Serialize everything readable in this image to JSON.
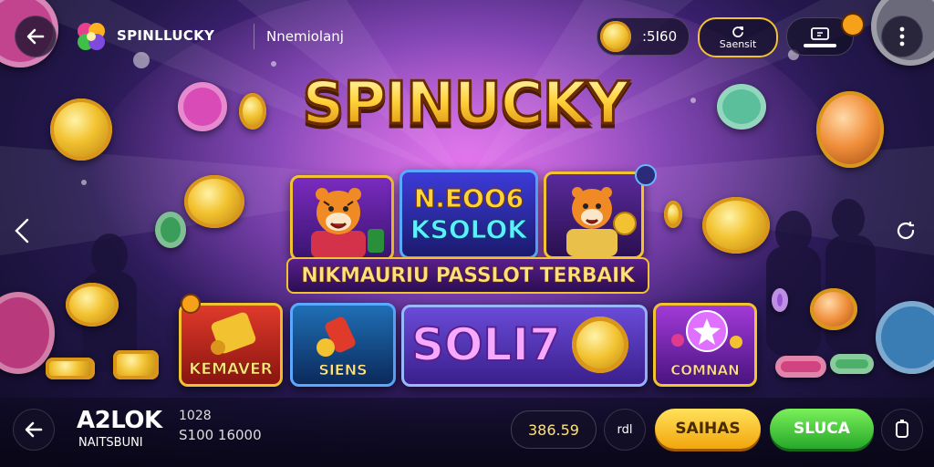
{
  "header": {
    "brand": "SPINLLUCKY",
    "subtitle": "Nnemiolanj",
    "balance": ":5I60",
    "action_label": "Saensit"
  },
  "hero": {
    "title": "SPINUCKY",
    "card_center_line1": "N.EOO6",
    "card_center_line2": "KSOLOK",
    "banner": "NIKMAURIU PASSLOT TERBAIK"
  },
  "games": [
    {
      "label": "KEMAVER"
    },
    {
      "label": "SIENS"
    },
    {
      "label": "SOLI7"
    },
    {
      "label": "COMNAN"
    }
  ],
  "footer": {
    "player_name": "A2LOK",
    "player_sub": "NAITSBUNI",
    "stat_top": "1028",
    "stat_bottom": "S100 16000",
    "amount": "386.59",
    "mid_label": "rdl",
    "yellow_button": "SAIHAS",
    "green_button": "SLUCA"
  },
  "colors": {
    "accent_gold": "#f2c230",
    "button_yellow": "#f7c51c",
    "button_green": "#3fcf3a",
    "badge_orange": "#f5a11a"
  }
}
